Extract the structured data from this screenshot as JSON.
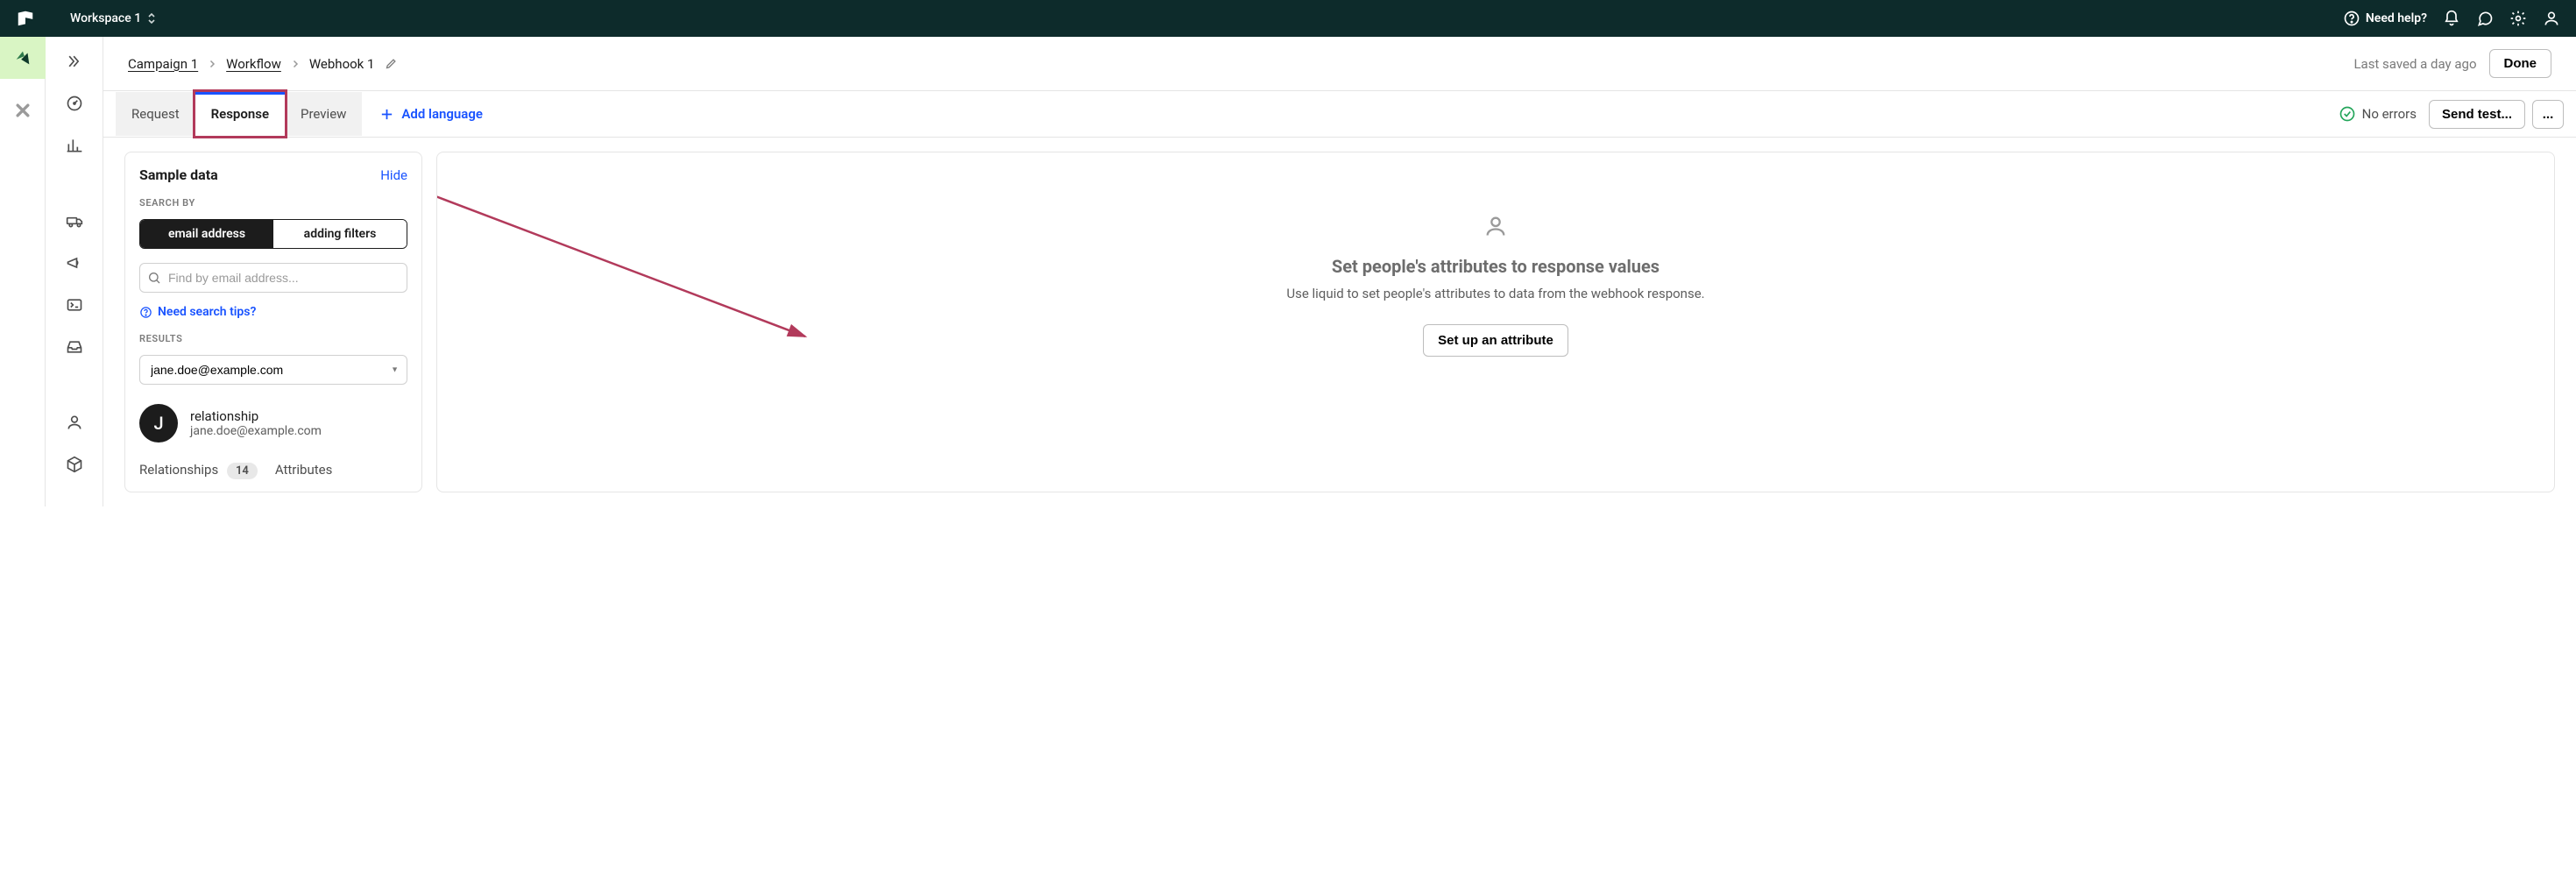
{
  "topbar": {
    "workspace": "Workspace 1",
    "need_help": "Need help?"
  },
  "header": {
    "crumb1": "Campaign 1",
    "crumb2": "Workflow",
    "crumb3": "Webhook 1",
    "last_saved": "Last saved a day ago",
    "done": "Done"
  },
  "tabs": {
    "request": "Request",
    "response": "Response",
    "preview": "Preview",
    "add_language": "Add language",
    "no_errors": "No errors",
    "send_test": "Send test...",
    "more": "..."
  },
  "sample": {
    "title": "Sample data",
    "hide": "Hide",
    "search_by": "SEARCH BY",
    "toggle_email": "email address",
    "toggle_filters": "adding filters",
    "search_placeholder": "Find by email address...",
    "tips": "Need search tips?",
    "results_label": "RESULTS",
    "result_selected": "jane.doe@example.com",
    "avatar_initial": "J",
    "relationship": "relationship",
    "email": "jane.doe@example.com",
    "subtab_rel": "Relationships",
    "subtab_rel_count": "14",
    "subtab_attr": "Attributes"
  },
  "main": {
    "title": "Set people's attributes to response values",
    "sub": "Use liquid to set people's attributes to data from the webhook response.",
    "button": "Set up an attribute"
  }
}
